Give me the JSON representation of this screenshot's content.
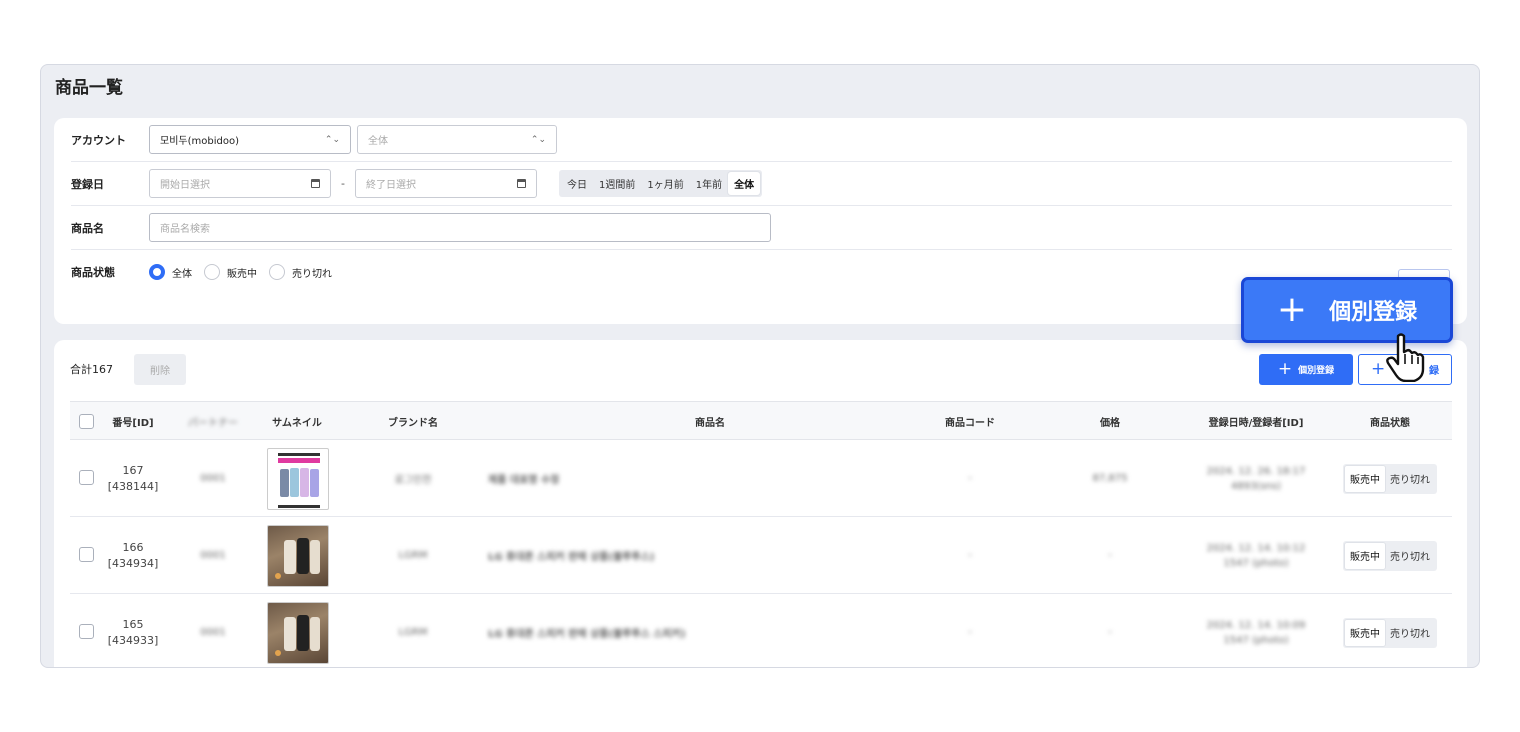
{
  "page": {
    "title": "商品一覧"
  },
  "filters": {
    "account": {
      "label": "アカウント",
      "value": "모비두(mobidoo)",
      "sub_placeholder": "全体"
    },
    "reg_date": {
      "label": "登録日",
      "start_placeholder": "開始日選択",
      "end_placeholder": "終了日選択",
      "separator": "-",
      "ranges": [
        "今日",
        "1週間前",
        "1ヶ月前",
        "1年前",
        "全体"
      ],
      "active_range": "全体"
    },
    "product_name": {
      "label": "商品名",
      "placeholder": "商品名検索"
    },
    "status": {
      "label": "商品状態",
      "options": [
        "全体",
        "販売中",
        "売り切れ"
      ],
      "selected": "全体"
    }
  },
  "list": {
    "total": "合計167",
    "delete_label": "削除",
    "register_label": "個別登録",
    "register2_label": "録",
    "columns": [
      "番号[ID]",
      "パートナー",
      "サムネイル",
      "ブランド名",
      "商品名",
      "商品コード",
      "価格",
      "登録日時/登録者[ID]",
      "商品状態"
    ],
    "rows": [
      {
        "no": "167",
        "id": "[438144]",
        "partner": "0001",
        "brand": "로그인전",
        "name": "제품 대표명 수정",
        "code": "-",
        "price": "87,875",
        "date": "2024. 12. 26. 18:17",
        "user": "4893(sns)",
        "thumb": "phone",
        "status_on": "販売中",
        "status_off": "売り切れ"
      },
      {
        "no": "166",
        "id": "[434934]",
        "partner": "0001",
        "brand": "LGRM",
        "name": "LG 휴대폰 스피커 판매 상품(블루투스)",
        "code": "-",
        "price": "-",
        "date": "2024. 12. 14. 10:12",
        "user": "1547 (photo)",
        "thumb": "speaker",
        "status_on": "販売中",
        "status_off": "売り切れ"
      },
      {
        "no": "165",
        "id": "[434933]",
        "partner": "0001",
        "brand": "LGRM",
        "name": "LG 휴대폰 스피커 판매 상품(블루투스 스피커)",
        "code": "-",
        "price": "-",
        "date": "2024. 12. 14. 10:09",
        "user": "1547 (photo)",
        "thumb": "speaker",
        "status_on": "販売中",
        "status_off": "売り切れ"
      }
    ]
  },
  "callout": {
    "label": "個別登録"
  },
  "colors": {
    "accent": "#2f6df6",
    "callout": "#3b79f7"
  }
}
